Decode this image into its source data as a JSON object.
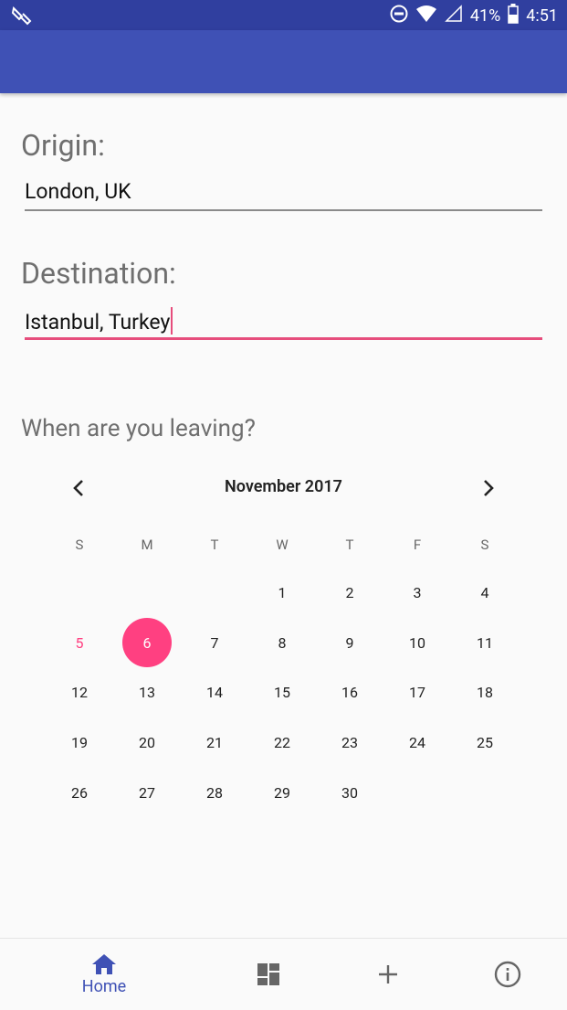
{
  "status": {
    "battery": "41%",
    "time": "4:51"
  },
  "origin": {
    "label": "Origin:",
    "value": "London, UK"
  },
  "destination": {
    "label": "Destination:",
    "value": "Istanbul, Turkey"
  },
  "calendar": {
    "prompt": "When are you leaving?",
    "month_title": "November 2017",
    "weekdays": [
      "S",
      "M",
      "T",
      "W",
      "T",
      "F",
      "S"
    ],
    "days": [
      {
        "day": 1,
        "col": 3,
        "row": 0
      },
      {
        "day": 2,
        "col": 4,
        "row": 0
      },
      {
        "day": 3,
        "col": 5,
        "row": 0
      },
      {
        "day": 4,
        "col": 6,
        "row": 0
      },
      {
        "day": 5,
        "col": 0,
        "row": 1,
        "state": "today"
      },
      {
        "day": 6,
        "col": 1,
        "row": 1,
        "state": "selected"
      },
      {
        "day": 7,
        "col": 2,
        "row": 1
      },
      {
        "day": 8,
        "col": 3,
        "row": 1
      },
      {
        "day": 9,
        "col": 4,
        "row": 1
      },
      {
        "day": 10,
        "col": 5,
        "row": 1
      },
      {
        "day": 11,
        "col": 6,
        "row": 1
      },
      {
        "day": 12,
        "col": 0,
        "row": 2
      },
      {
        "day": 13,
        "col": 1,
        "row": 2
      },
      {
        "day": 14,
        "col": 2,
        "row": 2
      },
      {
        "day": 15,
        "col": 3,
        "row": 2
      },
      {
        "day": 16,
        "col": 4,
        "row": 2
      },
      {
        "day": 17,
        "col": 5,
        "row": 2
      },
      {
        "day": 18,
        "col": 6,
        "row": 2
      },
      {
        "day": 19,
        "col": 0,
        "row": 3
      },
      {
        "day": 20,
        "col": 1,
        "row": 3
      },
      {
        "day": 21,
        "col": 2,
        "row": 3
      },
      {
        "day": 22,
        "col": 3,
        "row": 3
      },
      {
        "day": 23,
        "col": 4,
        "row": 3
      },
      {
        "day": 24,
        "col": 5,
        "row": 3
      },
      {
        "day": 25,
        "col": 6,
        "row": 3
      },
      {
        "day": 26,
        "col": 0,
        "row": 4
      },
      {
        "day": 27,
        "col": 1,
        "row": 4
      },
      {
        "day": 28,
        "col": 2,
        "row": 4
      },
      {
        "day": 29,
        "col": 3,
        "row": 4
      },
      {
        "day": 30,
        "col": 4,
        "row": 4
      }
    ]
  },
  "bottom_nav": {
    "home_label": "Home",
    "items": [
      {
        "icon": "home-icon",
        "label": "Home",
        "active": true
      },
      {
        "icon": "dashboard-icon"
      },
      {
        "icon": "add-icon"
      },
      {
        "icon": "info-icon"
      }
    ]
  },
  "colors": {
    "primary": "#3f51b5",
    "primary_dark": "#303f9f",
    "accent": "#ff4081"
  }
}
